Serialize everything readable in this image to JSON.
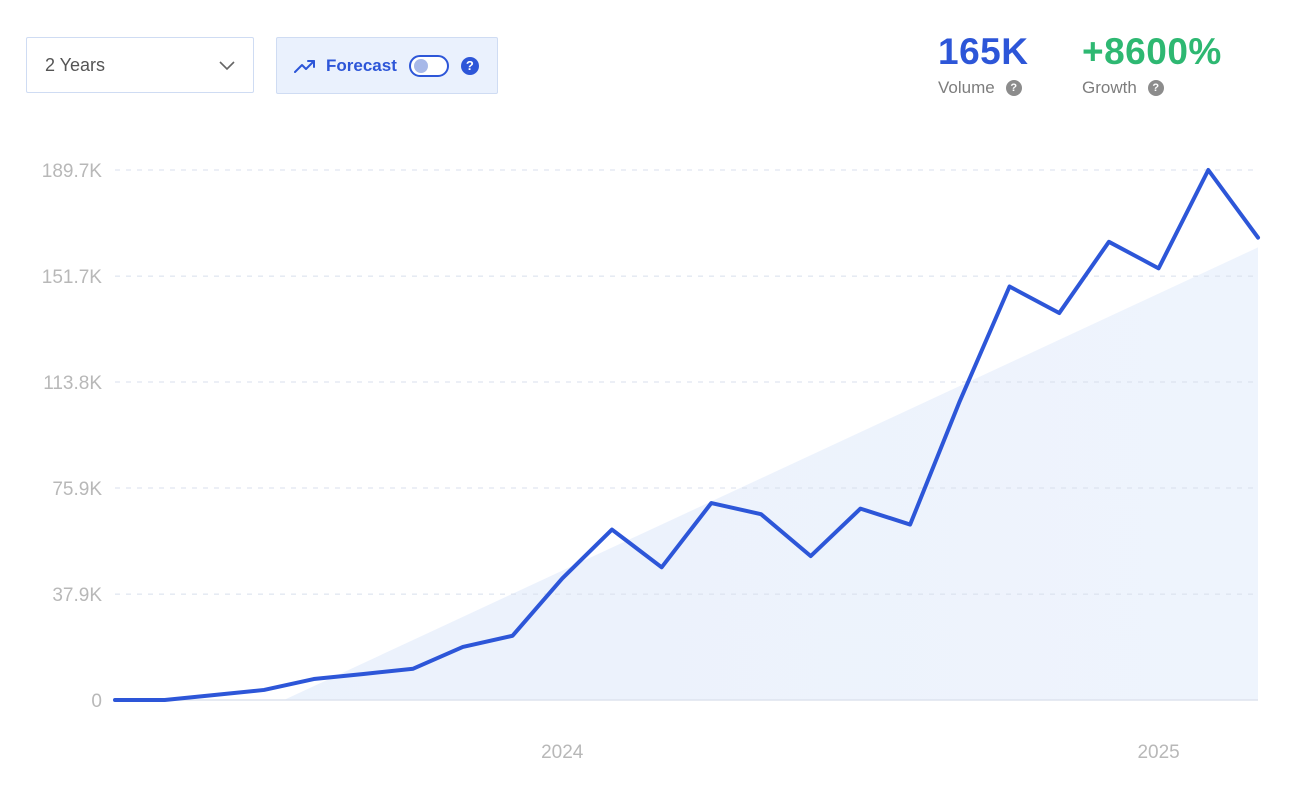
{
  "controls": {
    "range_label": "2 Years",
    "forecast_label": "Forecast",
    "forecast_on": false,
    "help_glyph": "?"
  },
  "stats": {
    "volume_value": "165K",
    "volume_label": "Volume",
    "growth_value": "+8600%",
    "growth_label": "Growth"
  },
  "colors": {
    "line": "#2d56d8",
    "trend_fill": "#e9f0fc",
    "growth": "#2eb872",
    "grid": "#d8dfec",
    "tick_text": "#b8b8b8"
  },
  "icons": {
    "range": "chevron-down-icon",
    "forecast": "trending-up-icon",
    "help": "question-mark-icon"
  },
  "chart_data": {
    "type": "line",
    "title": "",
    "xlabel": "",
    "ylabel": "",
    "ylim": [
      0,
      189700
    ],
    "y_ticks": [
      {
        "value": 0,
        "label": "0"
      },
      {
        "value": 37900,
        "label": "37.9K"
      },
      {
        "value": 75900,
        "label": "75.9K"
      },
      {
        "value": 113800,
        "label": "113.8K"
      },
      {
        "value": 151700,
        "label": "151.7K"
      },
      {
        "value": 189700,
        "label": "189.7K"
      }
    ],
    "x_ticks": [
      {
        "index": 9,
        "label": "2024"
      },
      {
        "index": 21,
        "label": "2025"
      }
    ],
    "grid": "horizontal-dashed",
    "series": [
      {
        "values": [
          0,
          0,
          1800,
          3600,
          7500,
          9300,
          11200,
          19000,
          23000,
          43500,
          61000,
          47500,
          70500,
          66500,
          51500,
          68500,
          62800,
          107000,
          148000,
          138500,
          164000,
          154500,
          189700,
          165500
        ]
      }
    ],
    "trend": {
      "start_index": 3.4,
      "start_value": 0,
      "end_value": 162000
    }
  }
}
